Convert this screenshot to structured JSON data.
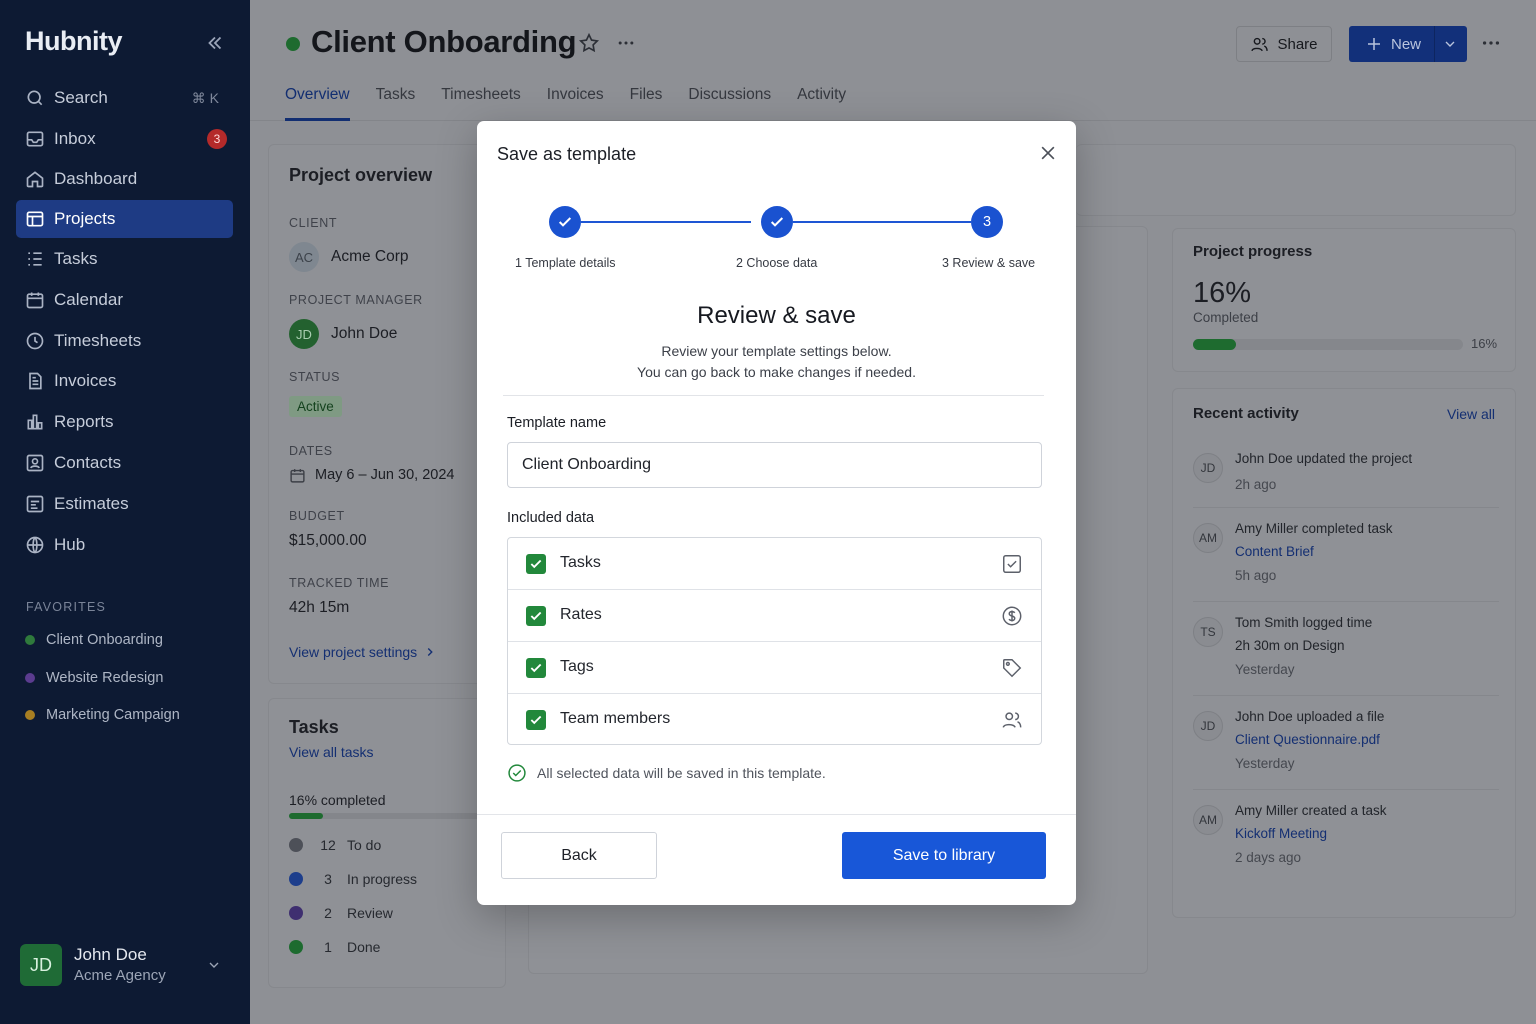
{
  "sidebar": {
    "logo": "Hubnity",
    "search_shortcut": "⌘ K",
    "inbox_badge": "3",
    "items": [
      {
        "label": "Search",
        "icon": "search-icon"
      },
      {
        "label": "Inbox",
        "icon": "inbox-icon"
      },
      {
        "label": "Dashboard",
        "icon": "home-icon"
      },
      {
        "label": "Projects",
        "icon": "projects-icon"
      },
      {
        "label": "Tasks",
        "icon": "list-icon"
      },
      {
        "label": "Calendar",
        "icon": "calendar-icon"
      },
      {
        "label": "Timesheets",
        "icon": "clock-icon"
      },
      {
        "label": "Invoices",
        "icon": "invoice-icon"
      },
      {
        "label": "Reports",
        "icon": "bar-chart-icon"
      },
      {
        "label": "Contacts",
        "icon": "contact-icon"
      },
      {
        "label": "Estimates",
        "icon": "estimate-icon"
      },
      {
        "label": "Hub",
        "icon": "globe-icon"
      }
    ],
    "favorites_title": "FAVORITES",
    "favorites": [
      {
        "label": "Client Onboarding",
        "color": "#2f7a3c"
      },
      {
        "label": "Website Redesign",
        "color": "#5b3c8f"
      },
      {
        "label": "Marketing Campaign",
        "color": "#a77e22"
      }
    ],
    "user": {
      "initials": "JD",
      "name": "John Doe",
      "org": "Acme Agency"
    }
  },
  "header": {
    "title": "Client Onboarding",
    "share_label": "Share",
    "new_label": "New",
    "tabs": [
      "Overview",
      "Tasks",
      "Timesheets",
      "Invoices",
      "Files",
      "Discussions",
      "Activity"
    ]
  },
  "overview": {
    "title": "Project overview",
    "client_label": "CLIENT",
    "client_initials": "AC",
    "client": "Acme Corp",
    "pm_label": "PROJECT MANAGER",
    "pm_initials": "JD",
    "pm": "John Doe",
    "status_label": "STATUS",
    "status": "Active",
    "dates_label": "DATES",
    "dates": "May 6 – Jun 30, 2024",
    "budget_label": "BUDGET",
    "budget": "$15,000.00",
    "tracked_label": "TRACKED TIME",
    "tracked": "42h 15m",
    "settings_link": "View project settings"
  },
  "tasks_card": {
    "title": "Tasks",
    "view_all": "View all tasks",
    "completed_text": "16% completed",
    "completed_fraction": 0.16,
    "legend": [
      {
        "count": "12",
        "label": "To do",
        "color": "#4d5058"
      },
      {
        "count": "3",
        "label": "In progress",
        "color": "#1d3e8c"
      },
      {
        "count": "2",
        "label": "Review",
        "color": "#3f2f70"
      },
      {
        "count": "1",
        "label": "Done",
        "color": "#1d6b2f"
      }
    ]
  },
  "progress": {
    "title": "Project progress",
    "percent_text": "16%",
    "completed_label": "Completed",
    "bar_label": "16%",
    "fraction": 0.16
  },
  "activity": {
    "title": "Recent activity",
    "view_all": "View all",
    "items": [
      {
        "initials": "JD",
        "text": "John Doe updated the project",
        "link": "",
        "time": "2h ago"
      },
      {
        "initials": "AM",
        "text": "Amy Miller completed task",
        "link": "Content Brief",
        "time": "5h ago"
      },
      {
        "initials": "TS",
        "text": "Tom Smith logged time",
        "link": "2h 30m on Design",
        "time": "Yesterday"
      },
      {
        "initials": "JD",
        "text": "John Doe uploaded a file",
        "link": "Client Questionnaire.pdf",
        "time": "Yesterday"
      },
      {
        "initials": "AM",
        "text": "Amy Miller created a task",
        "link": "Kickoff Meeting",
        "time": "2 days ago"
      }
    ]
  },
  "modal": {
    "title": "Save as template",
    "steps": [
      {
        "number": "1",
        "label": "1  Template details",
        "done": true
      },
      {
        "number": "2",
        "label": "2  Choose data",
        "done": true
      },
      {
        "number": "3",
        "label": "3  Review & save",
        "done": false
      }
    ],
    "heading": "Review & save",
    "desc_line1": "Review your template settings below.",
    "desc_line2": "You can go back to make changes if needed.",
    "name_label": "Template name",
    "name_value": "Client Onboarding",
    "included_label": "Included data",
    "included": [
      {
        "label": "Tasks",
        "checked": true,
        "icon": "checkbox-icon"
      },
      {
        "label": "Rates",
        "checked": true,
        "icon": "dollar-icon"
      },
      {
        "label": "Tags",
        "checked": true,
        "icon": "tag-icon"
      },
      {
        "label": "Team members",
        "checked": true,
        "icon": "users-icon"
      }
    ],
    "note": "All selected data will be saved in this template.",
    "back_label": "Back",
    "save_label": "Save to library"
  },
  "colors": {
    "sidebar_bg": "#0d1a33",
    "accent": "#1857d8",
    "check_green": "#22883b"
  }
}
